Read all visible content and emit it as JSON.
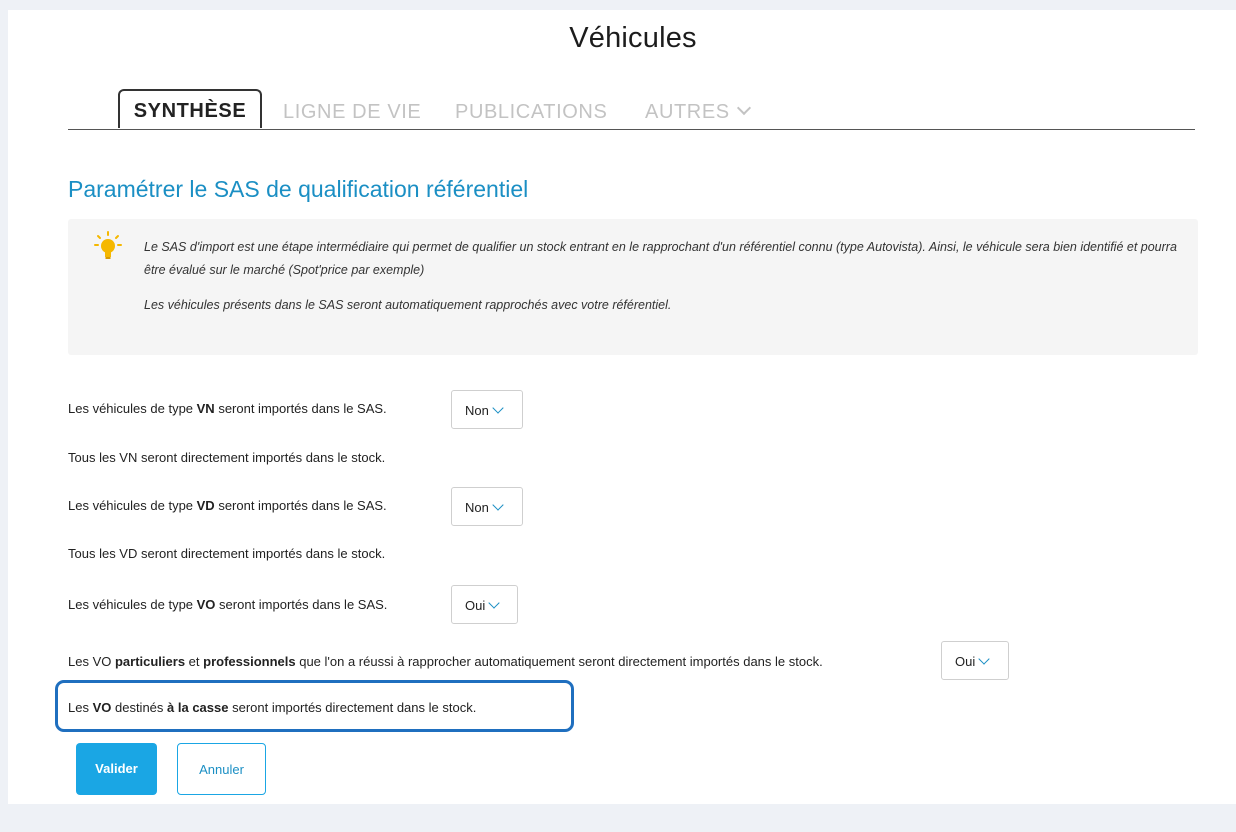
{
  "page": {
    "title": "Véhicules"
  },
  "tabs": [
    {
      "label": "SYNTHÈSE",
      "active": true
    },
    {
      "label": "LIGNE DE VIE",
      "active": false
    },
    {
      "label": "PUBLICATIONS",
      "active": false
    },
    {
      "label": "AUTRES",
      "active": false,
      "icon": "chevron-down-icon"
    }
  ],
  "section": {
    "title": "Paramétrer le SAS de qualification référentiel"
  },
  "info": {
    "icon": "lightbulb-icon",
    "paragraph1": "Le SAS d'import est une étape intermédiaire qui permet de qualifier un stock entrant en le rapprochant d'un référentiel connu (type Autovista). Ainsi, le véhicule sera bien identifié et pourra être évalué sur le marché (Spot'price par exemple)",
    "paragraph2": "Les véhicules présents dans le SAS seront automatiquement rapprochés avec votre référentiel."
  },
  "rows": {
    "vn": {
      "pre": "Les véhicules de type ",
      "bold": "VN",
      "post": " seront importés dans le SAS.",
      "select": "Non"
    },
    "vn_note": "Tous les VN seront directement importés dans le stock.",
    "vd": {
      "pre": "Les véhicules de type ",
      "bold": "VD",
      "post": " seront importés dans le SAS.",
      "select": "Non"
    },
    "vd_note": "Tous les VD seront directement importés dans le stock.",
    "vo": {
      "pre": "Les véhicules de type ",
      "bold": "VO",
      "post": " seront importés dans le SAS.",
      "select": "Oui"
    },
    "vo_pp": {
      "pre": "Les VO ",
      "bold1": "particuliers",
      "mid": " et ",
      "bold2": "professionnels",
      "post": " que l'on a réussi à rapprocher automatiquement seront directement importés dans le stock.",
      "select": "Oui"
    },
    "vo_casse": {
      "pre": "Les ",
      "bold1": "VO",
      "mid": " destinés ",
      "bold2": "à la casse",
      "post": " seront importés directement dans le stock."
    }
  },
  "buttons": {
    "valider": "Valider",
    "annuler": "Annuler"
  },
  "colors": {
    "accent": "#1aa6e4",
    "title_blue": "#1b8fc4",
    "highlight": "#1f6fbf"
  }
}
